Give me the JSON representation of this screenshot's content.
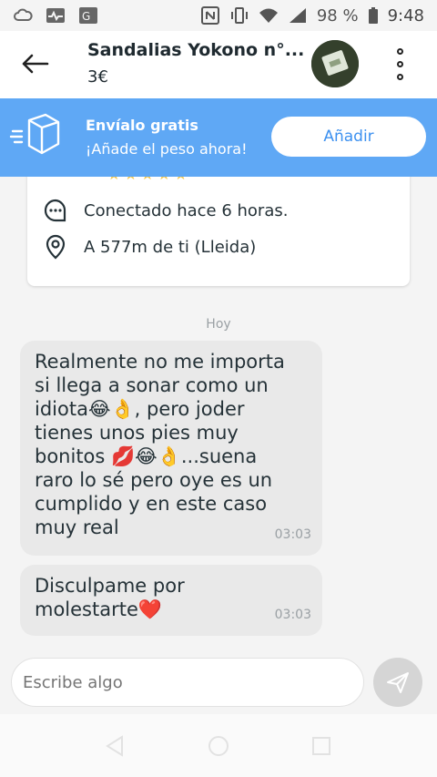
{
  "status_bar": {
    "battery": "98 %",
    "time": "9:48"
  },
  "header": {
    "title": "Sandalias Yokono n°...",
    "price": "3€"
  },
  "banner": {
    "title": "Envíalo gratis",
    "subtitle": "¡Añade el peso ahora!",
    "button_label": "Añadir",
    "color": "#5fa8f5"
  },
  "profile_card": {
    "rating_stars": "★★★★★",
    "connected": "Conectado hace 6 horas.",
    "location": "A 577m de ti (Lleida)"
  },
  "chat": {
    "day_label": "Hoy",
    "messages": [
      {
        "lines": [
          "Realmente no me importa",
          "si llega a sonar como un",
          "idiota😂👌, pero joder",
          "tienes unos pies muy",
          "bonitos 💋😂👌...suena",
          "raro lo sé pero oye es un",
          "cumplido y en este caso",
          "muy real"
        ],
        "time": "03:03"
      },
      {
        "lines": [
          "Disculpame por",
          "molestarte❤️"
        ],
        "time": "03:03"
      }
    ]
  },
  "composer": {
    "placeholder": "Escribe algo"
  }
}
